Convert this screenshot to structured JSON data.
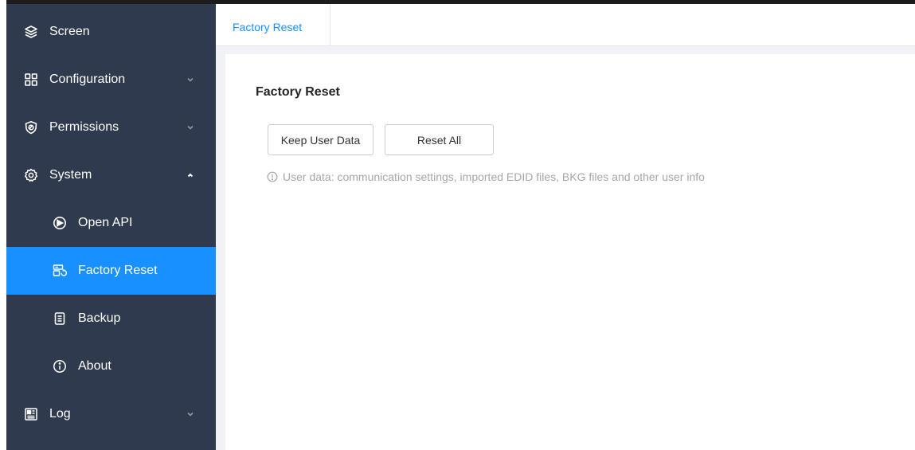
{
  "sidebar": {
    "items": [
      {
        "label": "Screen",
        "icon": "layers-icon",
        "has_chevron": false
      },
      {
        "label": "Configuration",
        "icon": "grid-icon",
        "has_chevron": true,
        "chevron": "down"
      },
      {
        "label": "Permissions",
        "icon": "shield-icon",
        "has_chevron": true,
        "chevron": "down"
      },
      {
        "label": "System",
        "icon": "gear-icon",
        "has_chevron": true,
        "chevron": "up",
        "expanded": true
      },
      {
        "label": "Open API",
        "icon": "api-icon",
        "sub": true
      },
      {
        "label": "Factory Reset",
        "icon": "factory-reset-icon",
        "sub": true,
        "active": true
      },
      {
        "label": "Backup",
        "icon": "backup-icon",
        "sub": true
      },
      {
        "label": "About",
        "icon": "info-icon",
        "sub": true
      },
      {
        "label": "Log",
        "icon": "log-icon",
        "has_chevron": true,
        "chevron": "down"
      }
    ]
  },
  "tabs": [
    {
      "label": "Factory Reset",
      "active": true
    }
  ],
  "main": {
    "title": "Factory Reset",
    "buttons": {
      "keep": "Keep User Data",
      "reset_all": "Reset All"
    },
    "hint": "User data: communication settings, imported EDID files, BKG files and other user info"
  },
  "colors": {
    "sidebar_bg": "#2f3a4e",
    "accent": "#1890ff",
    "content_bg": "#f0f2f5",
    "hint_text": "#a6a6a6"
  }
}
